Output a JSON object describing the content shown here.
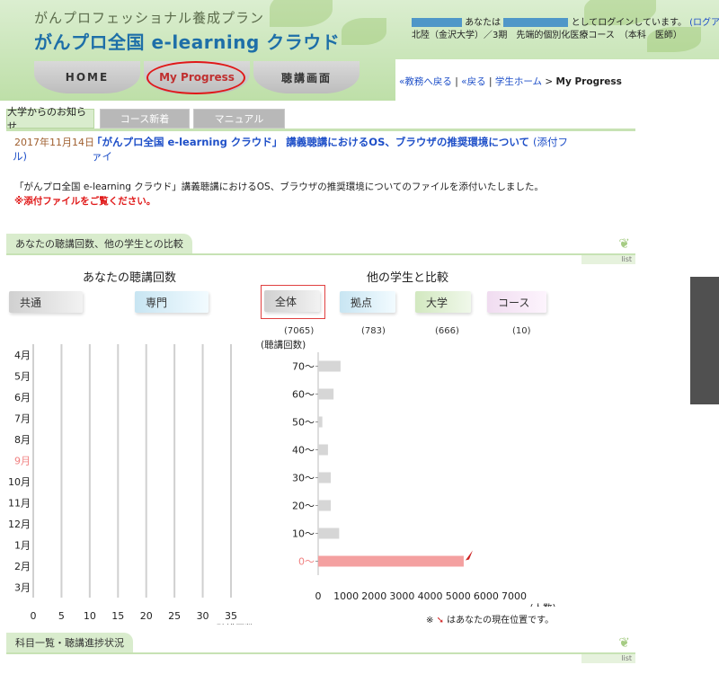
{
  "header": {
    "brand_sub": "がんプロフェッショナル養成プラン",
    "brand_main": "がんプロ全国 e-learning クラウド",
    "login_prefix": "あなたは",
    "login_suffix": "としてログインしています。",
    "logout_link": "(ログアウト)",
    "affiliation": "北陸（金沢大学）／3期　先端的個別化医療コース　（本科　医師）"
  },
  "nav": {
    "home": "HOME",
    "progress": "My Progress",
    "lecture": "聴講画面"
  },
  "breadcrumb": {
    "back_admin": "«教務へ戻る",
    "back": "«戻る",
    "student_home": "学生ホーム",
    "separator": "|",
    "arrow": ">",
    "current": "My Progress"
  },
  "tabs": [
    "大学からのお知らせ",
    "コース新着",
    "マニュアル"
  ],
  "news": {
    "date": "2017年11月14日",
    "title": "「がんプロ全国 e-learning クラウド」 講義聴講におけるOS、ブラウザの推奨環境について",
    "attach_open": "(添付ファイ",
    "attach_close": "ル)",
    "body": "「がんプロ全国 e-learning クラウド」講義聴講におけるOS、ブラウザの推奨環境についてのファイルを添付いたしました。",
    "warning": "※添付ファイルをご覧ください。"
  },
  "section1": {
    "label": "あなたの聴講回数、他の学生との比較",
    "list": "list"
  },
  "section2": {
    "label": "科目一覧・聴講進捗状況",
    "list": "list"
  },
  "left_panel": {
    "heading": "あなたの聴講回数",
    "buttons": [
      "共通",
      "専門"
    ]
  },
  "right_panel": {
    "heading": "他の学生と比較",
    "buttons": [
      "全体",
      "拠点",
      "大学",
      "コース"
    ],
    "counts": [
      "(7065)",
      "(783)",
      "(666)",
      "(10)"
    ]
  },
  "chart_data": [
    {
      "type": "bar",
      "orientation": "horizontal",
      "categories": [
        "4月",
        "5月",
        "6月",
        "7月",
        "8月",
        "9月",
        "10月",
        "11月",
        "12月",
        "1月",
        "2月",
        "3月"
      ],
      "highlight_category": "9月",
      "values": [
        0,
        0,
        0,
        0,
        0,
        0,
        0,
        0,
        0,
        0,
        0,
        0
      ],
      "x_ticks": [
        0,
        5,
        10,
        15,
        20,
        25,
        30,
        35
      ],
      "xlabel": "(聴講回数)",
      "xlim": [
        0,
        35
      ],
      "grid": true,
      "colors": {
        "gridline": "#d0d0d0",
        "highlight_label": "#f08080"
      }
    },
    {
      "type": "bar",
      "orientation": "horizontal",
      "categories": [
        "70〜",
        "60〜",
        "50〜",
        "40〜",
        "30〜",
        "20〜",
        "10〜",
        "0〜"
      ],
      "highlight_category": "0〜",
      "values": [
        800,
        550,
        150,
        350,
        450,
        450,
        750,
        5200
      ],
      "x_ticks": [
        0,
        1000,
        2000,
        3000,
        4000,
        5000,
        6000,
        7000
      ],
      "xlabel": "(人数)",
      "ylabel": "(聴講回数)",
      "xlim": [
        0,
        7000
      ],
      "your_position_category": "0〜",
      "colors": {
        "bar": "#d6d6d6",
        "highlight_bar": "#f4a0a0",
        "highlight_label": "#f08080",
        "marker": "#cc2020"
      }
    }
  ],
  "footnote": {
    "prefix": "※",
    "text": "はあなたの現在位置です。"
  }
}
